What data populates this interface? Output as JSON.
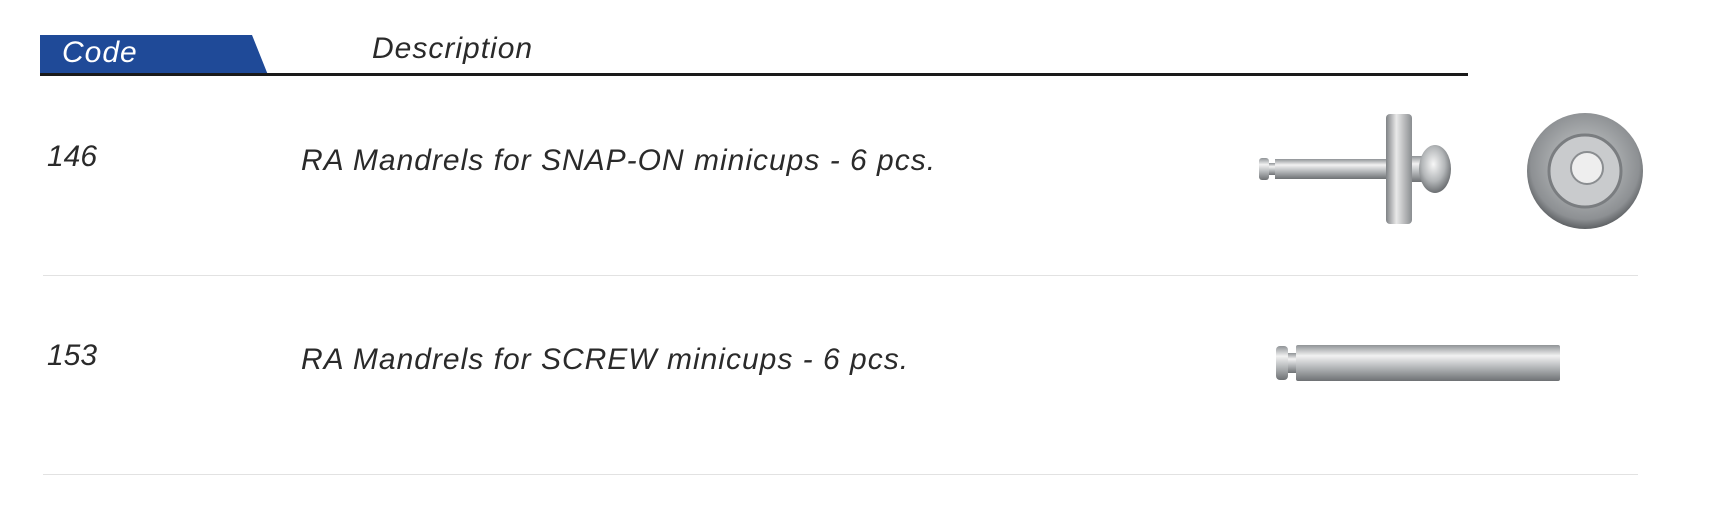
{
  "header": {
    "code_label": "Code",
    "description_label": "Description"
  },
  "rows": [
    {
      "code": "146",
      "description": "RA Mandrels for SNAP-ON minicups - 6 pcs.",
      "image": "snap-on-mandrel-image"
    },
    {
      "code": "153",
      "description": "RA Mandrels for SCREW minicups - 6 pcs.",
      "image": "screw-mandrel-image"
    }
  ],
  "colors": {
    "header_tab": "#1f4a98",
    "text": "#2a2a2a",
    "rule": "#1a1a1a",
    "row_separator": "#e2e2e2"
  }
}
